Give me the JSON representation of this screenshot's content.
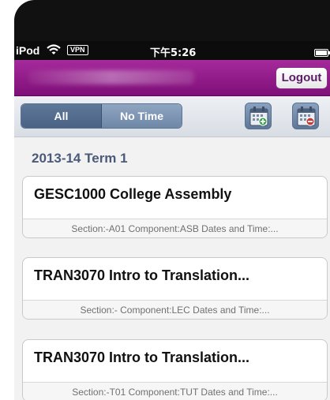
{
  "status_bar": {
    "carrier": "iPod",
    "vpn": "VPN",
    "time": "下午5:26"
  },
  "nav": {
    "logout_label": "Logout"
  },
  "toolbar": {
    "filter_all": "All",
    "filter_no_time": "No Time",
    "selected_filter": "All"
  },
  "term": "2013-14 Term 1",
  "courses": [
    {
      "title": "GESC1000 College Assembly",
      "detail": "Section:-A01 Component:ASB Dates and Time:..."
    },
    {
      "title": "TRAN3070 Intro to Translation...",
      "detail": "Section:- Component:LEC Dates and Time:..."
    },
    {
      "title": "TRAN3070 Intro to Translation...",
      "detail": "Section:-T01 Component:TUT Dates and Time:..."
    }
  ],
  "icons": {
    "wifi": "wifi-icon",
    "battery": "battery-icon",
    "calendar_add": "calendar-add-icon",
    "calendar_remove": "calendar-remove-icon"
  },
  "colors": {
    "nav_bar": "#8e1a87",
    "toolbar_accent": "#5e7899",
    "term_header": "#4a5a78"
  }
}
